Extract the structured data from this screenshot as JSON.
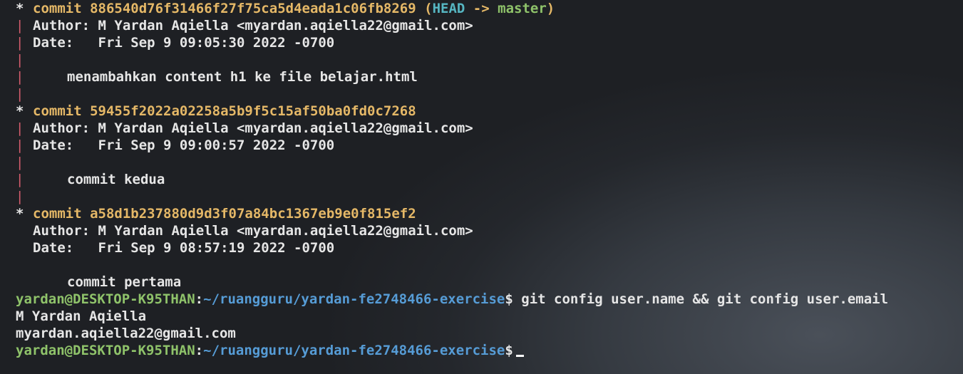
{
  "commits": [
    {
      "star": "*",
      "label": "commit",
      "hash": "886540d76f31466f27f75ca5d4eada1c06fb8269",
      "ref_open": "(",
      "ref_head": "HEAD",
      "ref_arrow": "->",
      "ref_branch": "master",
      "ref_close": ")",
      "author": "Author: M Yardan Aqiella <myardan.aqiella22@gmail.com>",
      "date": "Date:   Fri Sep 9 09:05:30 2022 -0700",
      "message": "menambahkan content h1 ke file belajar.html"
    },
    {
      "star": "*",
      "label": "commit",
      "hash": "59455f2022a02258a5b9f5c15af50ba0fd0c7268",
      "author": "Author: M Yardan Aqiella <myardan.aqiella22@gmail.com>",
      "date": "Date:   Fri Sep 9 09:00:57 2022 -0700",
      "message": "commit kedua"
    },
    {
      "star": "*",
      "label": "commit",
      "hash": "a58d1b237880d9d3f07a84bc1367eb9e0f815ef2",
      "author": "Author: M Yardan Aqiella <myardan.aqiella22@gmail.com>",
      "date": "Date:   Fri Sep 9 08:57:19 2022 -0700",
      "message": "commit pertama"
    }
  ],
  "graph_bar": "|",
  "prompt": {
    "user_host": "yardan@DESKTOP-K95THAN",
    "colon": ":",
    "path": "~/ruangguru/yardan-fe2748466-exercise",
    "dollar": "$"
  },
  "command": "git config user.name && git config user.email",
  "output": [
    "M Yardan Aqiella",
    "myardan.aqiella22@gmail.com"
  ],
  "colors": {
    "background": "#1e2024",
    "hash": "#e5b867",
    "head": "#56b6c2",
    "branch": "#8fc36a",
    "graph_bar": "#d65d6e",
    "prompt_user": "#8fc36a",
    "prompt_path": "#569cd6"
  }
}
